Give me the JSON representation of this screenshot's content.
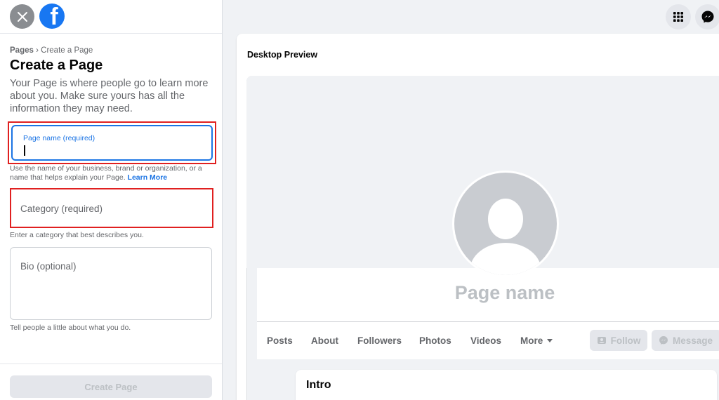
{
  "window": {
    "close_label": "Close",
    "logo_letter": "f"
  },
  "breadcrumb": {
    "root": "Pages",
    "separator": "›",
    "current": "Create a Page"
  },
  "form": {
    "title": "Create a Page",
    "description": "Your Page is where people go to learn more about you. Make sure yours has all the information they may need.",
    "page_name": {
      "label": "Page name (required)",
      "value": ""
    },
    "page_name_help": "Use the name of your business, brand or organization, or a name that helps explain your Page.",
    "learn_more": "Learn More",
    "category": {
      "placeholder": "Category (required)"
    },
    "category_help": "Enter a category that best describes you.",
    "bio": {
      "placeholder": "Bio (optional)"
    },
    "bio_help": "Tell people a little about what you do.",
    "create_button": "Create Page"
  },
  "preview": {
    "title": "Desktop Preview",
    "page_name": "Page name",
    "tabs": [
      "Posts",
      "About",
      "Followers",
      "Photos",
      "Videos",
      "More"
    ],
    "follow_button": "Follow",
    "message_button": "Message",
    "intro_title": "Intro"
  },
  "colors": {
    "accent": "#1877f2",
    "highlight_border": "#e02020",
    "muted_text": "#65676b",
    "disabled_text": "#bcc0c4"
  }
}
